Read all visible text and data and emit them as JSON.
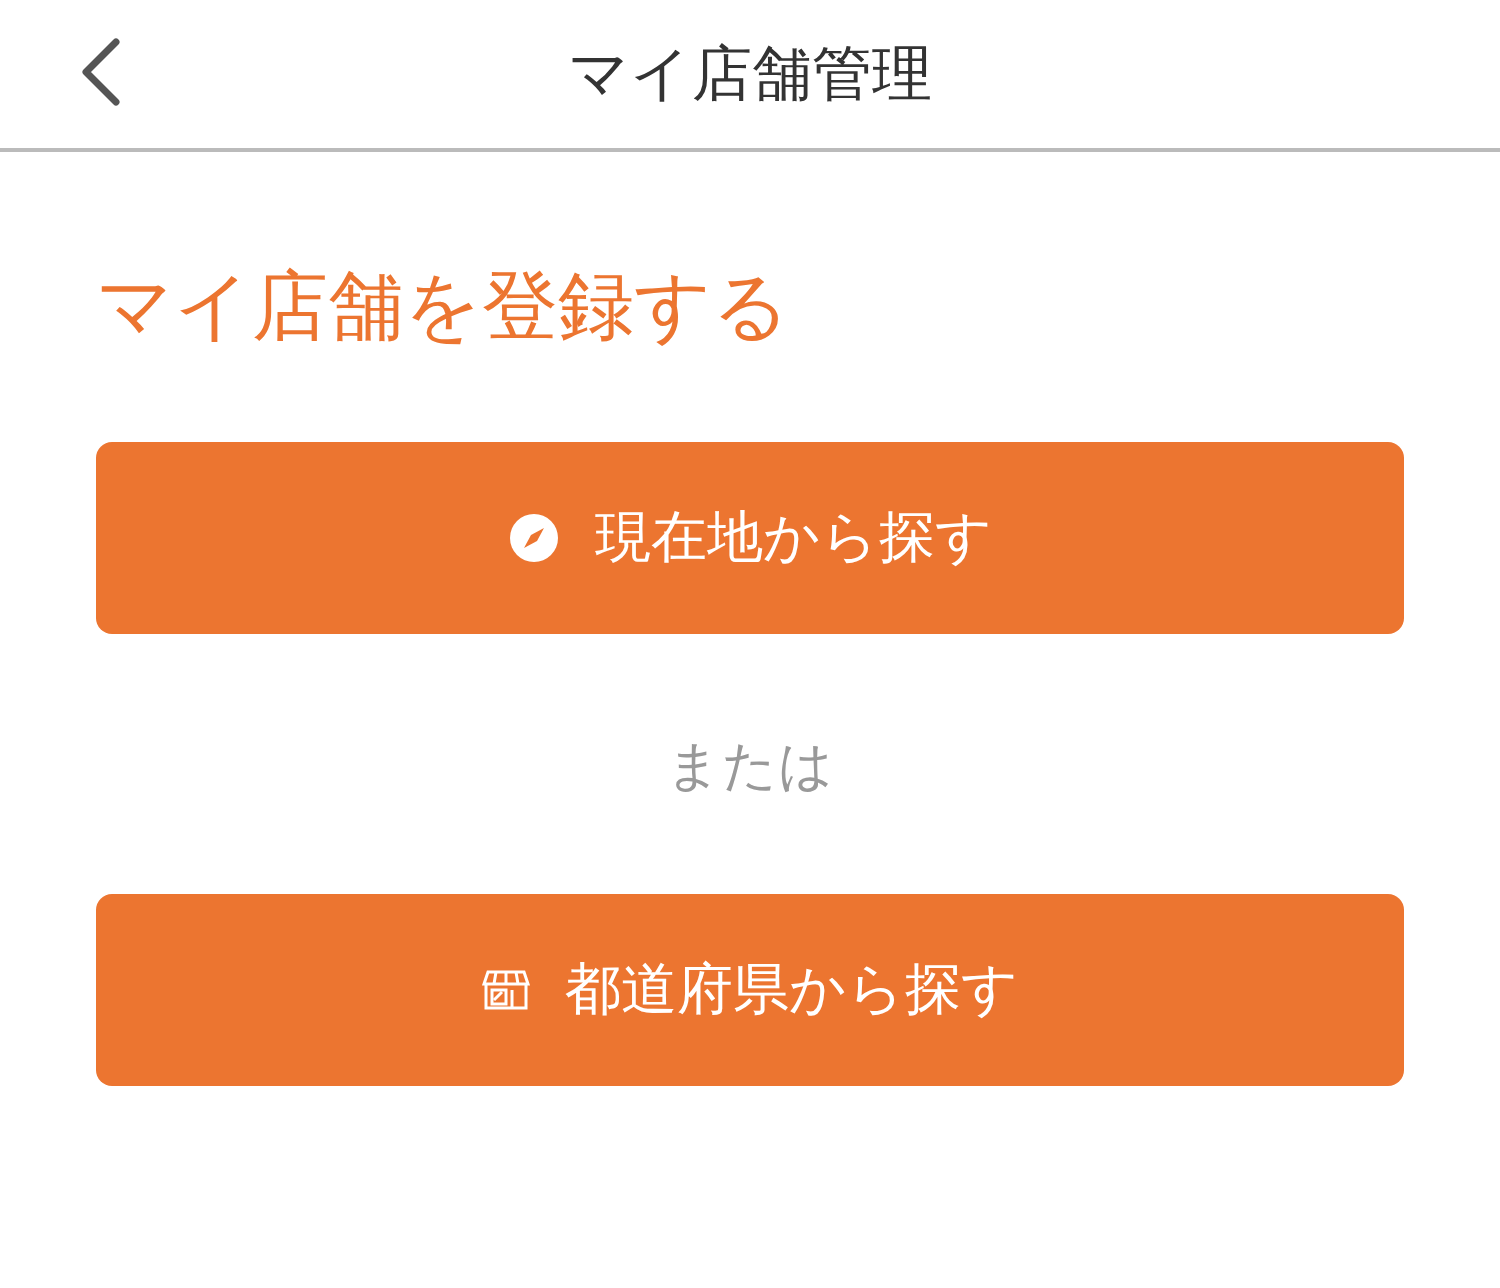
{
  "header": {
    "title": "マイ店舗管理"
  },
  "heading": "マイ店舗を登録する",
  "buttons": [
    {
      "kind": "location",
      "label": "現在地から探す"
    },
    {
      "kind": "store",
      "label": "都道府県から探す"
    }
  ],
  "separator": "または"
}
